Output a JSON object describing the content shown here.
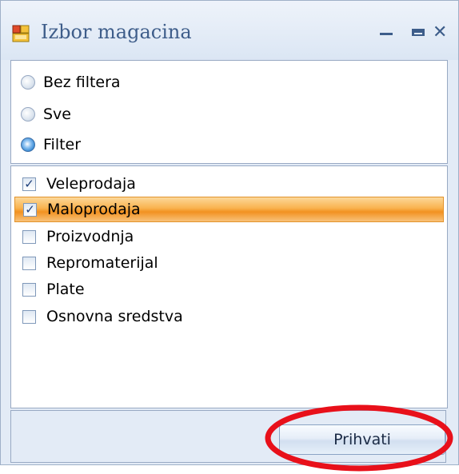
{
  "window": {
    "title": "Izbor magacina"
  },
  "filter_options": [
    {
      "label": "Bez filtera",
      "selected": false
    },
    {
      "label": "Sve",
      "selected": false
    },
    {
      "label": "Filter",
      "selected": true
    }
  ],
  "warehouses": [
    {
      "label": "Veleprodaja",
      "checked": true,
      "highlighted": false
    },
    {
      "label": "Maloprodaja",
      "checked": true,
      "highlighted": true
    },
    {
      "label": "Proizvodnja",
      "checked": false,
      "highlighted": false
    },
    {
      "label": "Repromaterijal",
      "checked": false,
      "highlighted": false
    },
    {
      "label": "Plate",
      "checked": false,
      "highlighted": false
    },
    {
      "label": "Osnovna sredstva",
      "checked": false,
      "highlighted": false
    }
  ],
  "buttons": {
    "accept_label": "Prihvati"
  },
  "colors": {
    "title_text": "#3e5d8a",
    "selection": "#f29120",
    "annotation": "#e8101a"
  }
}
